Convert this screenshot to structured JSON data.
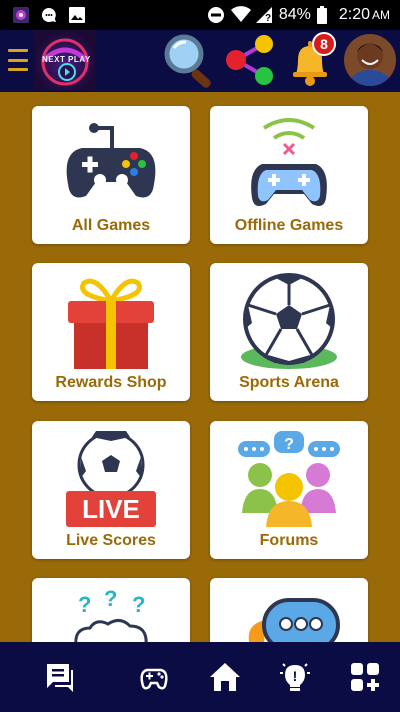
{
  "status_bar": {
    "battery": "84%",
    "time": "2:20",
    "ampm": "AM",
    "left_icons": [
      "app-icon",
      "chat-icon",
      "image-icon"
    ],
    "right_icons": [
      "do-not-disturb-icon",
      "wifi-icon",
      "signal-icon",
      "battery-icon"
    ]
  },
  "header": {
    "menu_icon": "hamburger-icon",
    "logo_text": "NEXT PLAY",
    "search_icon": "magnifier-icon",
    "share_icon": "share-icon",
    "bell_icon": "bell-icon",
    "notification_count": "8",
    "avatar": "user-avatar"
  },
  "tiles": [
    {
      "label": "All Games",
      "icon": "gamepad-icon"
    },
    {
      "label": "Offline Games",
      "icon": "offline-gamepad-icon"
    },
    {
      "label": "Rewards Shop",
      "icon": "gift-icon"
    },
    {
      "label": "Sports Arena",
      "icon": "soccer-ball-icon"
    },
    {
      "label": "Live Scores",
      "icon": "live-scores-icon"
    },
    {
      "label": "Forums",
      "icon": "forums-icon"
    },
    {
      "label": "",
      "icon": "questions-icon"
    },
    {
      "label": "",
      "icon": "chat-bubble-icon"
    }
  ],
  "bottom_nav": [
    {
      "icon": "messages-icon"
    },
    {
      "icon": "gamepad-icon"
    },
    {
      "icon": "home-icon"
    },
    {
      "icon": "lightbulb-icon"
    },
    {
      "icon": "add-widget-icon"
    }
  ],
  "colors": {
    "background": "#9a6a08",
    "appbar": "#0c0c45",
    "tile_label": "#9a6a08",
    "badge": "#d81b1b",
    "hamburger": "#d6a520"
  }
}
